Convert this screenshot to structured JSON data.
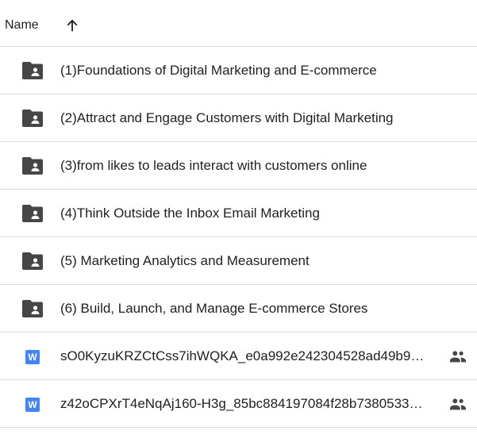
{
  "header": {
    "name_label": "Name",
    "sort_icon": "arrow-up-icon"
  },
  "colors": {
    "text": "#1f1f1f",
    "folder_icon": "#444746",
    "doc_icon": "#4285f4",
    "divider": "#dadce0"
  },
  "folders": [
    {
      "label": "(1)Foundations of Digital Marketing and E-commerce",
      "icon": "shared-folder-icon"
    },
    {
      "label": "(2)Attract and Engage Customers with Digital Marketing",
      "icon": "shared-folder-icon"
    },
    {
      "label": "(3)from likes to leads interact with customers online",
      "icon": "shared-folder-icon"
    },
    {
      "label": "(4)Think Outside the Inbox Email Marketing",
      "icon": "shared-folder-icon"
    },
    {
      "label": "(5) Marketing Analytics and Measurement",
      "icon": "shared-folder-icon"
    },
    {
      "label": "(6) Build, Launch, and Manage E-commerce Stores",
      "icon": "shared-folder-icon"
    }
  ],
  "files": [
    {
      "label": "sO0KyzuKRZCtCss7ihWQKA_e0a992e242304528ad49b9…",
      "icon_letter": "W",
      "icon": "word-doc-icon",
      "shared_icon": "people-icon"
    },
    {
      "label": "z42oCPXrT4eNqAj160-H3g_85bc884197084f28b7380533…",
      "icon_letter": "W",
      "icon": "word-doc-icon",
      "shared_icon": "people-icon"
    }
  ]
}
